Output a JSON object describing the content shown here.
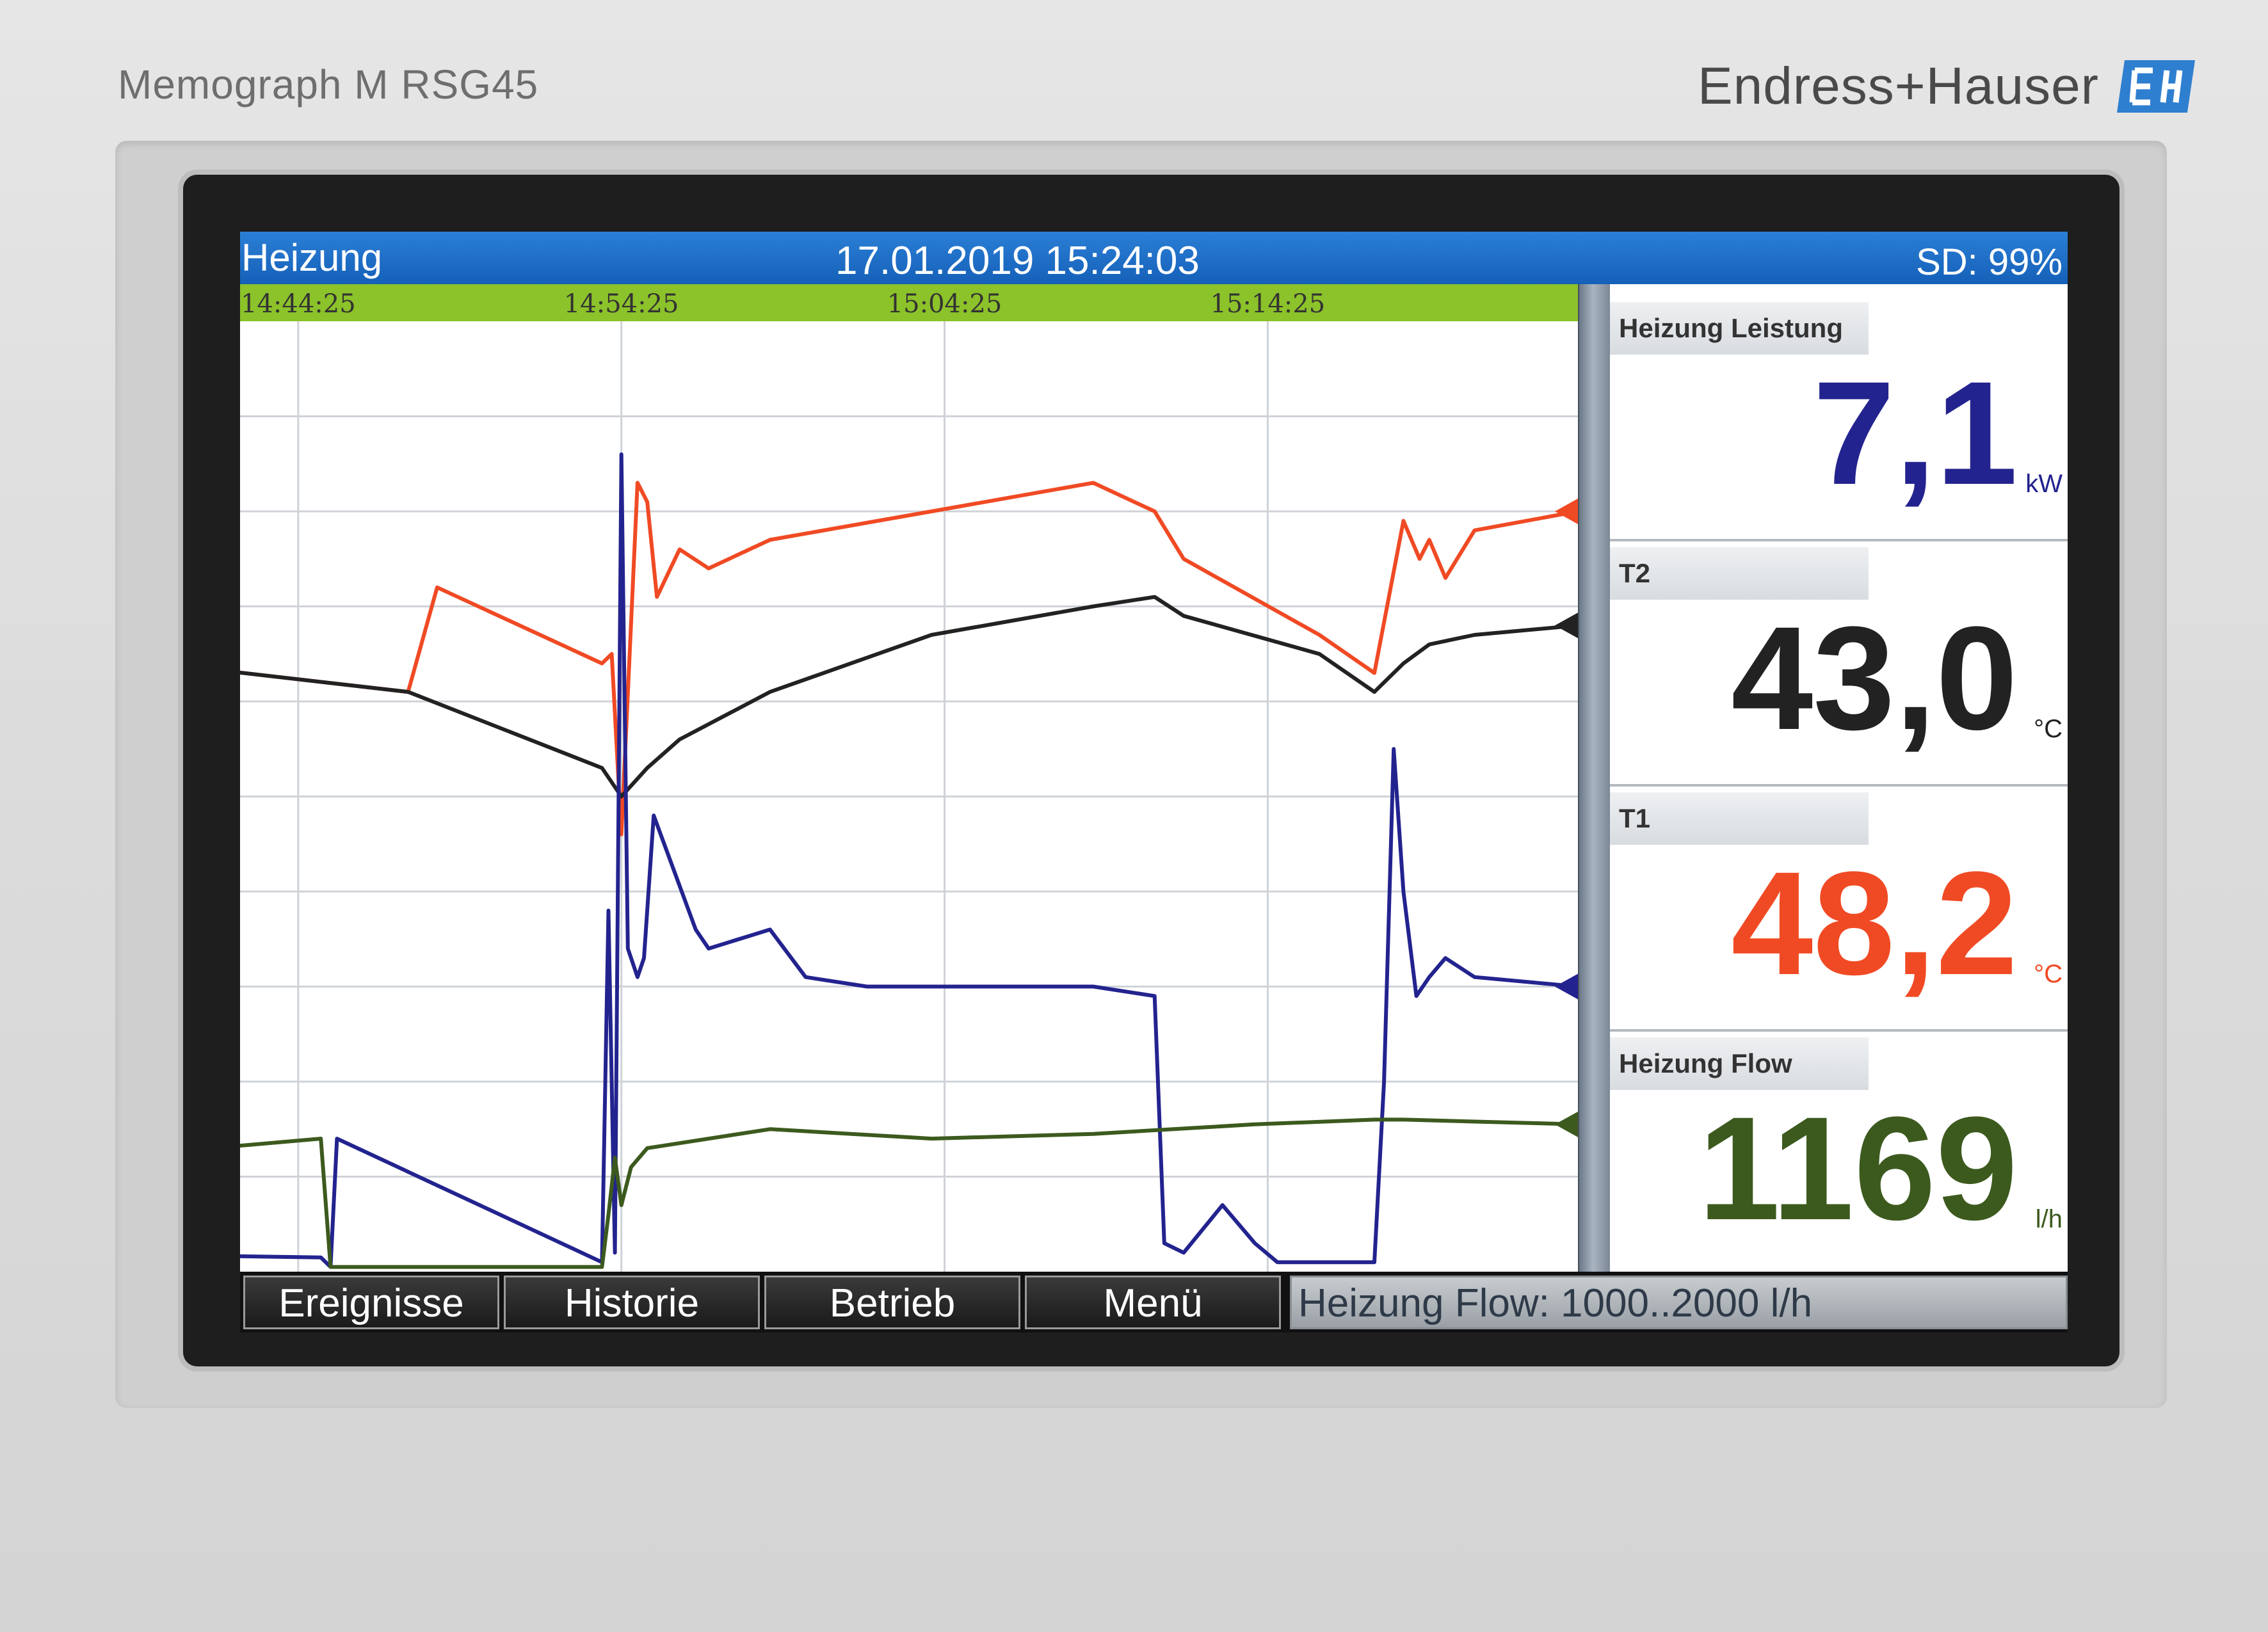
{
  "device": {
    "model": "Memograph M RSG45",
    "brand": "Endress+Hauser",
    "logo_icon": "eh-logo-icon"
  },
  "header": {
    "title": "Heizung",
    "datetime": "17.01.2019 15:24:03",
    "sd_status": "SD: 99%"
  },
  "colors": {
    "header_blue": "#1560b8",
    "timebar_green": "#8cc22a",
    "power_blue": "#23238f",
    "t2_black": "#222222",
    "t1_orange": "#f04a24",
    "flow_green": "#3c5a1e"
  },
  "channels": [
    {
      "label": "Heizung Leistung",
      "value": "7,1",
      "unit": "kW",
      "color": "#23238f"
    },
    {
      "label": "T2",
      "value": "43,0",
      "unit": "°C",
      "color": "#222222"
    },
    {
      "label": "T1",
      "value": "48,2",
      "unit": "°C",
      "color": "#f04a24"
    },
    {
      "label": "Heizung Flow",
      "value": "1169",
      "unit": "l/h",
      "color": "#3c5a1e"
    }
  ],
  "softkeys": [
    "Ereignisse",
    "Historie",
    "Betrieb",
    "Menü"
  ],
  "status_field": "Heizung Flow: 1000..2000 l/h",
  "chart_data": {
    "type": "line",
    "x_unit": "minutes",
    "xlim": [
      -41.4,
      0
    ],
    "ylim": [
      0,
      10
    ],
    "grid": true,
    "time_ticks": [
      {
        "label": "14:44:25",
        "x": -39.6
      },
      {
        "label": "14:54:25",
        "x": -29.6
      },
      {
        "label": "15:04:25",
        "x": -19.6
      },
      {
        "label": "15:14:25",
        "x": -9.6
      }
    ],
    "series": [
      {
        "channel": "T1",
        "color": "#f04a24",
        "x": [
          -49,
          -36.2,
          -35.3,
          -30.2,
          -29.9,
          -29.6,
          -29.1,
          -28.8,
          -28.5,
          -27.8,
          -26.9,
          -25,
          -20,
          -15,
          -13.1,
          -12.2,
          -8,
          -6.3,
          -5.4,
          -4.9,
          -4.6,
          -4.1,
          -3.2,
          0
        ],
        "y": [
          6.6,
          6.1,
          7.2,
          6.4,
          6.5,
          4.6,
          8.3,
          8.1,
          7.1,
          7.6,
          7.4,
          7.7,
          8.0,
          8.3,
          8.0,
          7.5,
          6.7,
          6.3,
          7.9,
          7.5,
          7.7,
          7.3,
          7.8,
          8.0
        ]
      },
      {
        "channel": "T2",
        "color": "#222222",
        "x": [
          -49,
          -36.2,
          -30.2,
          -29.6,
          -28.8,
          -27.8,
          -25,
          -20,
          -15,
          -13.1,
          -12.2,
          -8,
          -6.3,
          -5.4,
          -4.6,
          -3.2,
          0
        ],
        "y": [
          6.6,
          6.1,
          5.3,
          5.0,
          5.3,
          5.6,
          6.1,
          6.7,
          7.0,
          7.1,
          6.9,
          6.5,
          6.1,
          6.4,
          6.6,
          6.7,
          6.8
        ]
      },
      {
        "channel": "Heizung Leistung",
        "color": "#23238f",
        "x": [
          -49,
          -38.9,
          -38.6,
          -38.4,
          -30.2,
          -30.0,
          -29.8,
          -29.6,
          -29.4,
          -29.1,
          -28.9,
          -28.6,
          -27.3,
          -26.9,
          -25,
          -23.9,
          -22,
          -15,
          -13.1,
          -12.8,
          -12.2,
          -11,
          -10,
          -9.3,
          -6.3,
          -6.0,
          -5.7,
          -5.4,
          -5.0,
          -4.6,
          -4.1,
          -3.2,
          0
        ],
        "y": [
          0.2,
          0.15,
          0.05,
          1.4,
          0.1,
          3.8,
          0.2,
          8.6,
          3.4,
          3.1,
          3.3,
          4.8,
          3.6,
          3.4,
          3.6,
          3.1,
          3.0,
          3.0,
          2.9,
          0.3,
          0.2,
          0.7,
          0.3,
          0.1,
          0.1,
          2.0,
          5.5,
          4.0,
          2.9,
          3.1,
          3.3,
          3.1,
          3.0
        ]
      },
      {
        "channel": "Heizung Flow",
        "color": "#3c5a1e",
        "x": [
          -49,
          -38.9,
          -38.6,
          -38.4,
          -30.2,
          -30.0,
          -29.8,
          -29.6,
          -29.3,
          -28.8,
          -25,
          -20,
          -15,
          -10,
          -6.3,
          -5.4,
          0
        ],
        "y": [
          1.1,
          1.4,
          0.05,
          0.05,
          0.05,
          0.6,
          1.2,
          0.7,
          1.1,
          1.3,
          1.5,
          1.4,
          1.45,
          1.55,
          1.6,
          1.6,
          1.55
        ]
      }
    ]
  }
}
